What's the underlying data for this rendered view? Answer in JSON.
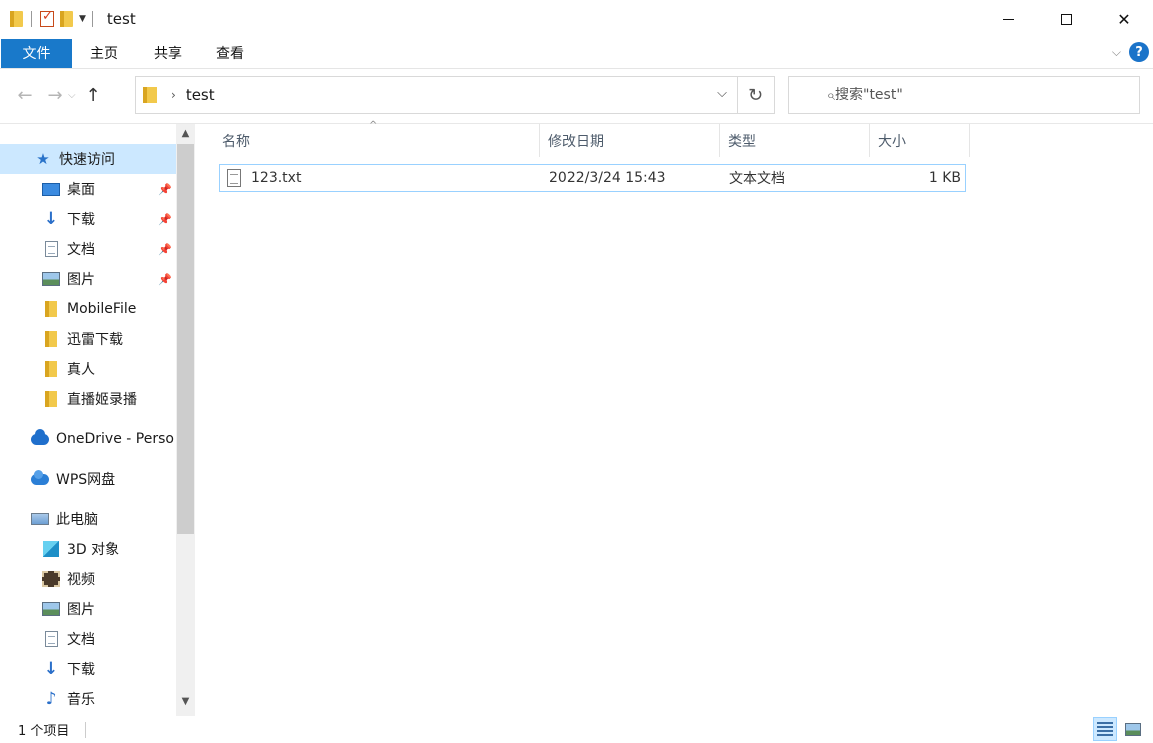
{
  "window": {
    "title": "test",
    "minimize_label": "",
    "close_symbol": "✕"
  },
  "ribbon": {
    "tabs": [
      "文件",
      "主页",
      "共享",
      "查看"
    ],
    "help_symbol": "?",
    "expand_symbol": "⌵"
  },
  "address": {
    "breadcrumb": "test",
    "refresh_symbol": "↻",
    "search_placeholder": "搜索\"test\""
  },
  "sidebar": {
    "quick_access": "快速访问",
    "pinned": [
      "桌面",
      "下载",
      "文档",
      "图片"
    ],
    "folders": [
      "MobileFile",
      "迅雷下载",
      "真人",
      "直播姬录播"
    ],
    "onedrive": "OneDrive - Perso",
    "wps": "WPS网盘",
    "this_pc": "此电脑",
    "pc_items": [
      "3D 对象",
      "视频",
      "图片",
      "文档",
      "下载",
      "音乐"
    ]
  },
  "columns": {
    "name": "名称",
    "modified": "修改日期",
    "type": "类型",
    "size": "大小"
  },
  "files": [
    {
      "name": "123.txt",
      "modified": "2022/3/24 15:43",
      "type": "文本文档",
      "size": "1 KB"
    }
  ],
  "status": {
    "item_count": "1 个项目"
  }
}
